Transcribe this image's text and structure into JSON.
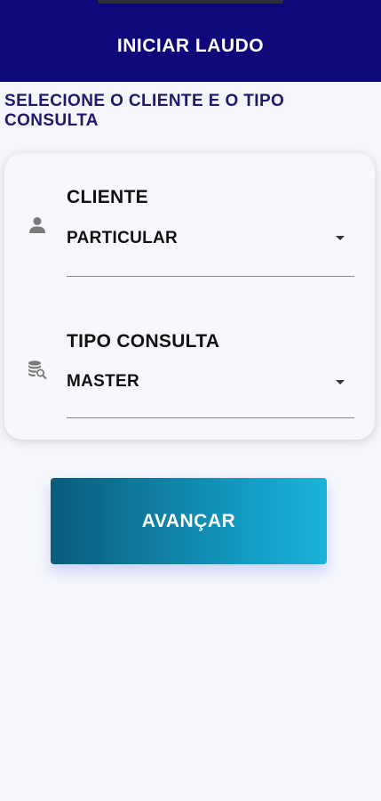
{
  "header": {
    "title": "INICIAR LAUDO"
  },
  "subtitle": "SELECIONE O CLIENTE E O TIPO CONSULTA",
  "form": {
    "cliente": {
      "label": "CLIENTE",
      "value": "PARTICULAR",
      "icon": "person-icon"
    },
    "tipo_consulta": {
      "label": "TIPO CONSULTA",
      "value": "MASTER",
      "icon": "database-search-icon"
    }
  },
  "actions": {
    "advance_label": "AVANÇAR"
  },
  "colors": {
    "header_bg": "#0f087a",
    "subtitle": "#1c1a6b",
    "button_gradient_start": "#0a5c7c",
    "button_gradient_end": "#1cb2db",
    "background": "#f5f6fc"
  }
}
